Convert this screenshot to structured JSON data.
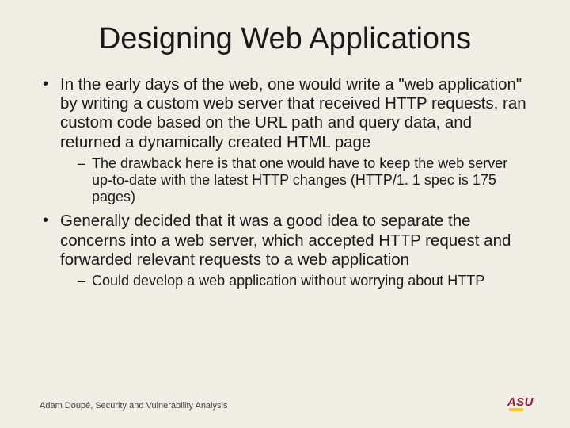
{
  "title": "Designing Web Applications",
  "bullets": {
    "b1": "In the early days of the web, one would write a \"web application\" by writing a custom web server that received HTTP requests, ran custom code based on the URL path and query data, and returned a dynamically created HTML page",
    "b1_sub": "The drawback here is that one would have to keep the web server up-to-date with the latest HTTP changes (HTTP/1. 1 spec is 175 pages)",
    "b2": "Generally decided that it was a good idea to separate the concerns into a web server, which accepted HTTP request and forwarded relevant requests to a web application",
    "b2_sub": "Could develop a web application without worrying about HTTP"
  },
  "footer": "Adam Doupé, Security and Vulnerability Analysis",
  "logo_text": "ASU"
}
